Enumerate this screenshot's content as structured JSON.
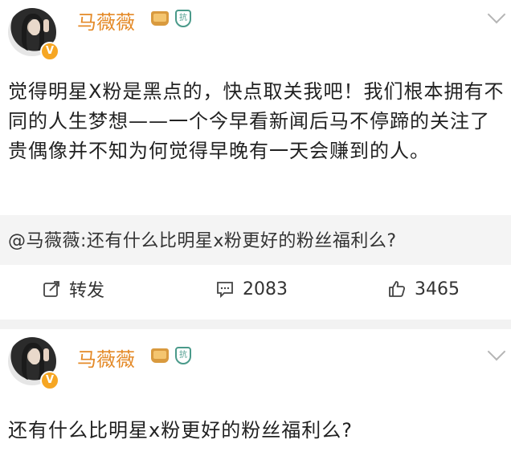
{
  "posts": [
    {
      "author": "马薇薇",
      "verified_badge": "V",
      "member_badge": "抗",
      "text": "觉得明星X粉是黑点的，快点取关我吧！我们根本拥有不同的人生梦想——一个今早看新闻后马不停蹄的关注了贵偶像并不知为何觉得早晚有一天会赚到的人。",
      "quoted": "@马薇薇:还有什么比明星x粉更好的粉丝福利么?",
      "actions": {
        "repost_label": "转发",
        "comment_count": "2083",
        "like_count": "3465"
      }
    },
    {
      "author": "马薇薇",
      "verified_badge": "V",
      "member_badge": "抗",
      "text": "还有什么比明星x粉更好的粉丝福利么?"
    }
  ],
  "colors": {
    "author_name": "#e48a28",
    "vip_badge": "#f6a623",
    "background_divider": "#f2f2f2"
  }
}
